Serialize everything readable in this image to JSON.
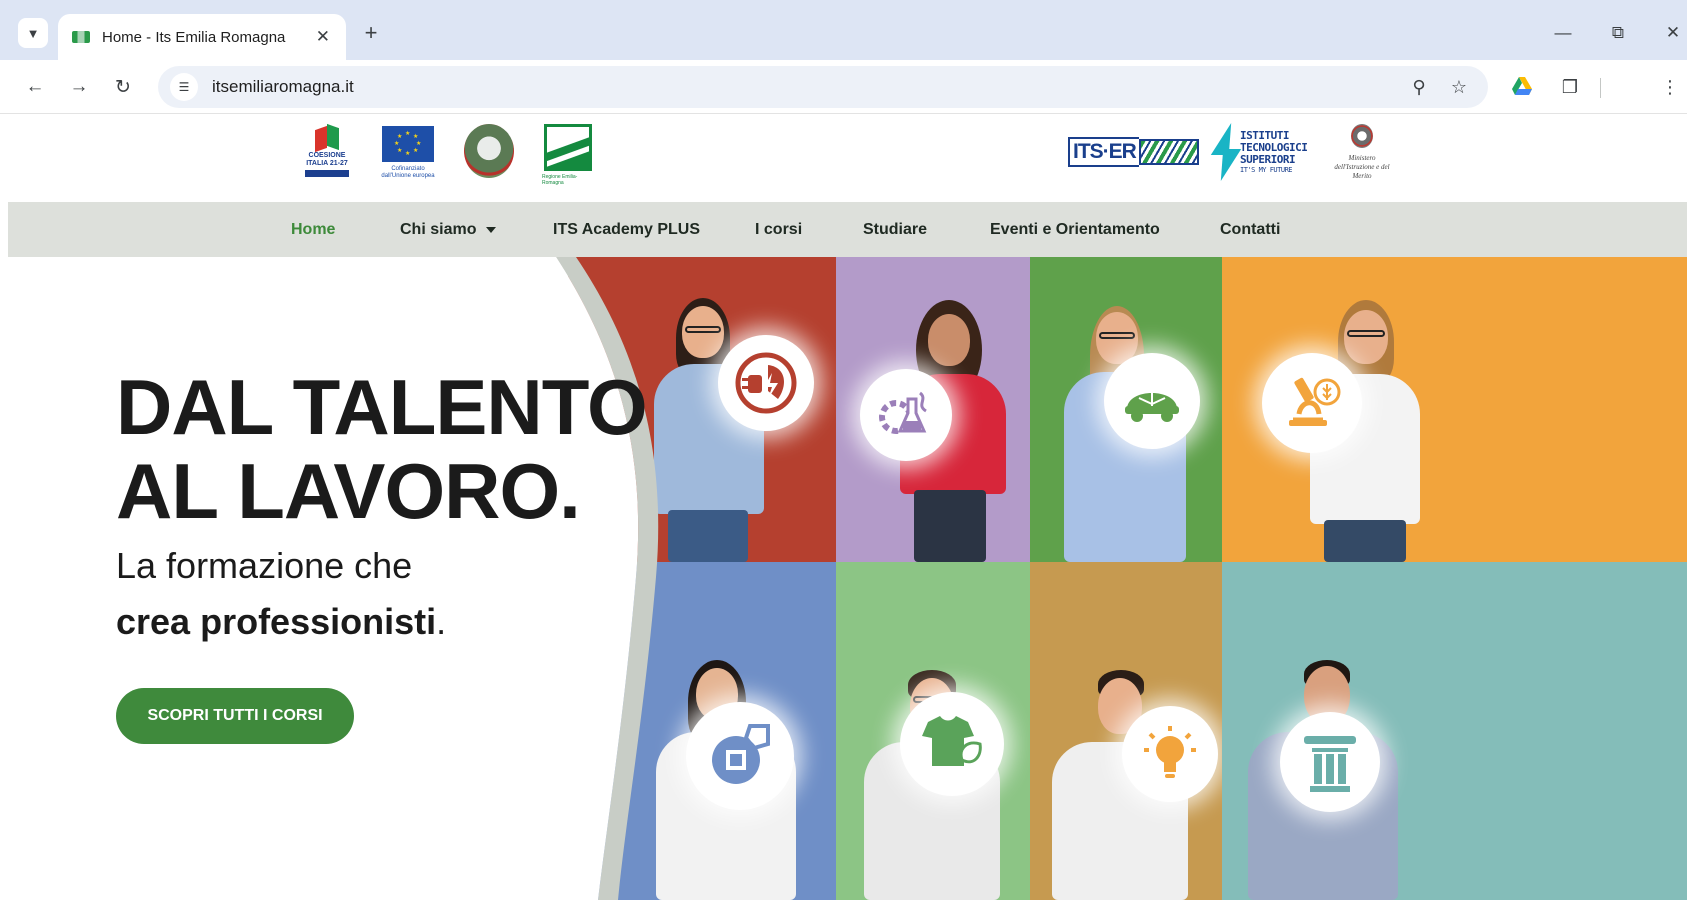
{
  "browser": {
    "tab_title": "Home - Its Emilia Romagna",
    "url": "itsemiliaromagna.it"
  },
  "logos": {
    "coesione": "COESIONE ITALIA 21-27",
    "eu": "Cofinanziato dall'Unione europea",
    "regione": "Regione Emilia-Romagna",
    "itser": "ITS·ER",
    "its_lines": [
      "ISTITUTI",
      "TECNOLOGICI",
      "SUPERIORI",
      "IT'S MY FUTURE"
    ],
    "ministero": "Ministero dell'Istruzione e del Merito"
  },
  "nav": {
    "items": [
      {
        "label": "Home",
        "active": true
      },
      {
        "label": "Chi siamo",
        "dropdown": true
      },
      {
        "label": "ITS Academy PLUS"
      },
      {
        "label": "I corsi"
      },
      {
        "label": "Studiare"
      },
      {
        "label": "Eventi e Orientamento"
      },
      {
        "label": "Contatti"
      }
    ]
  },
  "hero": {
    "headline_line1": "DAL TALENTO",
    "headline_line2": "AL LAVORO.",
    "sub_line1": "La formazione che",
    "sub_line2_bold": "crea professionisti",
    "sub_line2_end": ".",
    "cta_label": "SCOPRI TUTTI I CORSI"
  },
  "tiles": [
    {
      "icon": "energy-plug-leaf-icon",
      "color": "#b5402f"
    },
    {
      "icon": "gear-flask-dna-icon",
      "color": "#b39bc9"
    },
    {
      "icon": "electric-car-leaf-icon",
      "color": "#5fa14b"
    },
    {
      "icon": "microscope-wheat-icon",
      "color": "#f2a43c"
    },
    {
      "icon": "chip-gear-tag-icon",
      "color": "#6f8fc7"
    },
    {
      "icon": "tshirt-leaf-icon",
      "color": "#8cc585"
    },
    {
      "icon": "lightbulb-icon",
      "color": "#c69a50"
    },
    {
      "icon": "column-icon",
      "color": "#84bdb9"
    }
  ],
  "colors": {
    "accent_green": "#3f8a3c",
    "nav_bg": "#dde0db",
    "chrome_bg": "#dde5f4"
  }
}
